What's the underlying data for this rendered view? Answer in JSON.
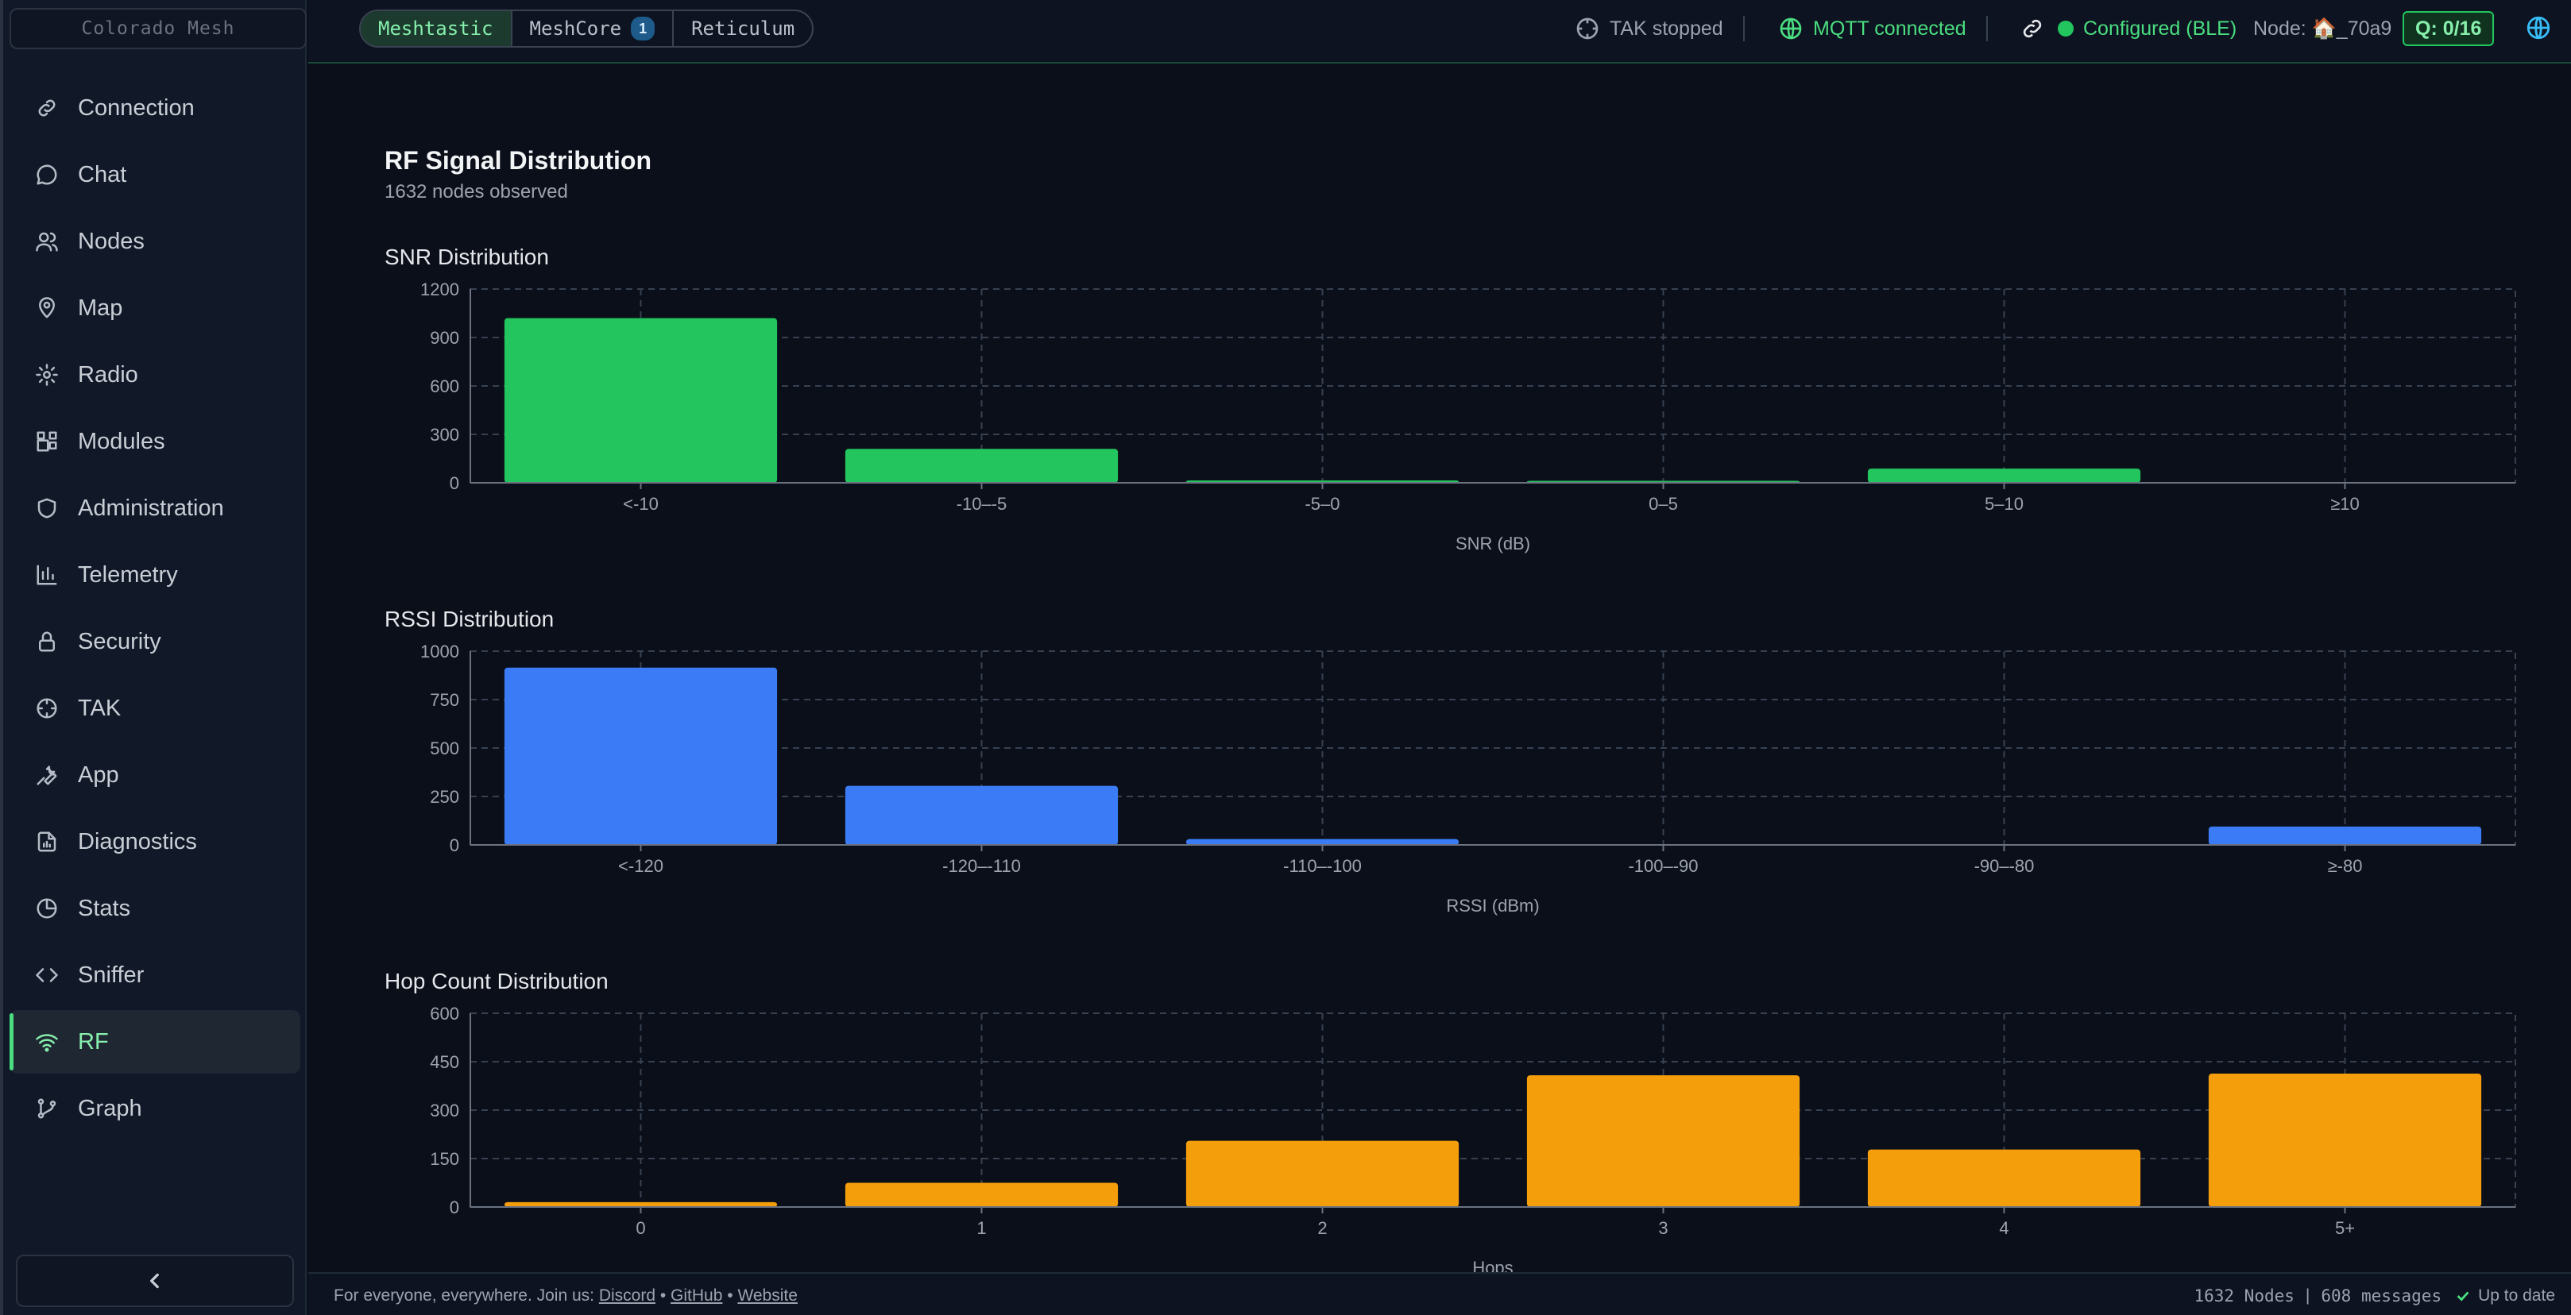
{
  "sidebar": {
    "mesh_name": "Colorado Mesh",
    "items": [
      {
        "label": "Connection",
        "icon": "link-icon"
      },
      {
        "label": "Chat",
        "icon": "chat-icon"
      },
      {
        "label": "Nodes",
        "icon": "users-icon"
      },
      {
        "label": "Map",
        "icon": "map-pin-icon"
      },
      {
        "label": "Radio",
        "icon": "gear-icon"
      },
      {
        "label": "Modules",
        "icon": "modules-icon"
      },
      {
        "label": "Administration",
        "icon": "shield-icon"
      },
      {
        "label": "Telemetry",
        "icon": "bar-chart-icon"
      },
      {
        "label": "Security",
        "icon": "lock-icon"
      },
      {
        "label": "TAK",
        "icon": "crosshair-icon"
      },
      {
        "label": "App",
        "icon": "wrench-icon"
      },
      {
        "label": "Diagnostics",
        "icon": "file-chart-icon"
      },
      {
        "label": "Stats",
        "icon": "pie-chart-icon"
      },
      {
        "label": "Sniffer",
        "icon": "code-icon"
      },
      {
        "label": "RF",
        "icon": "wifi-icon",
        "active": true
      },
      {
        "label": "Graph",
        "icon": "git-branch-icon"
      }
    ]
  },
  "topbar": {
    "tabs": [
      {
        "label": "Meshtastic",
        "active": true
      },
      {
        "label": "MeshCore",
        "badge": "1"
      },
      {
        "label": "Reticulum"
      }
    ],
    "tak_status": "TAK stopped",
    "mqtt_status": "MQTT connected",
    "config_status": "Configured (BLE)",
    "node_label": "Node: 🏠_70a9",
    "queue": "Q: 0/16"
  },
  "page": {
    "title": "RF Signal Distribution",
    "subtitle": "1632 nodes observed"
  },
  "chart_data": [
    {
      "type": "bar",
      "title": "SNR Distribution",
      "categories": [
        "<-10",
        "-10–-5",
        "-5–0",
        "0–5",
        "5–10",
        "≥10"
      ],
      "values": [
        1020,
        210,
        15,
        12,
        88,
        0
      ],
      "xlabel": "SNR (dB)",
      "ylabel": "",
      "ylim": [
        0,
        1200
      ],
      "yticks": [
        0,
        300,
        600,
        900,
        1200
      ],
      "color": "#22c55e",
      "grid": true
    },
    {
      "type": "bar",
      "title": "RSSI Distribution",
      "categories": [
        "<-120",
        "-120–-110",
        "-110–-100",
        "-100–-90",
        "-90–-80",
        "≥-80"
      ],
      "values": [
        915,
        305,
        30,
        0,
        0,
        95
      ],
      "xlabel": "RSSI (dBm)",
      "ylabel": "",
      "ylim": [
        0,
        1000
      ],
      "yticks": [
        0,
        250,
        500,
        750,
        1000
      ],
      "color": "#3b7cf6",
      "grid": true
    },
    {
      "type": "bar",
      "title": "Hop Count Distribution",
      "categories": [
        "0",
        "1",
        "2",
        "3",
        "4",
        "5+"
      ],
      "values": [
        15,
        75,
        205,
        408,
        178,
        413
      ],
      "xlabel": "Hops",
      "ylabel": "",
      "ylim": [
        0,
        600
      ],
      "yticks": [
        0,
        150,
        300,
        450,
        600
      ],
      "color": "#f59e0b",
      "grid": true
    }
  ],
  "footer": {
    "tagline": "For everyone, everywhere. Join us:",
    "links": [
      "Discord",
      "GitHub",
      "Website"
    ],
    "nodes": "1632 Nodes",
    "messages": "608 messages",
    "update": "Up to date"
  },
  "colors": {
    "accent": "#4ade80",
    "mqtt": "#4ade80",
    "tak": "#9ca3af"
  }
}
